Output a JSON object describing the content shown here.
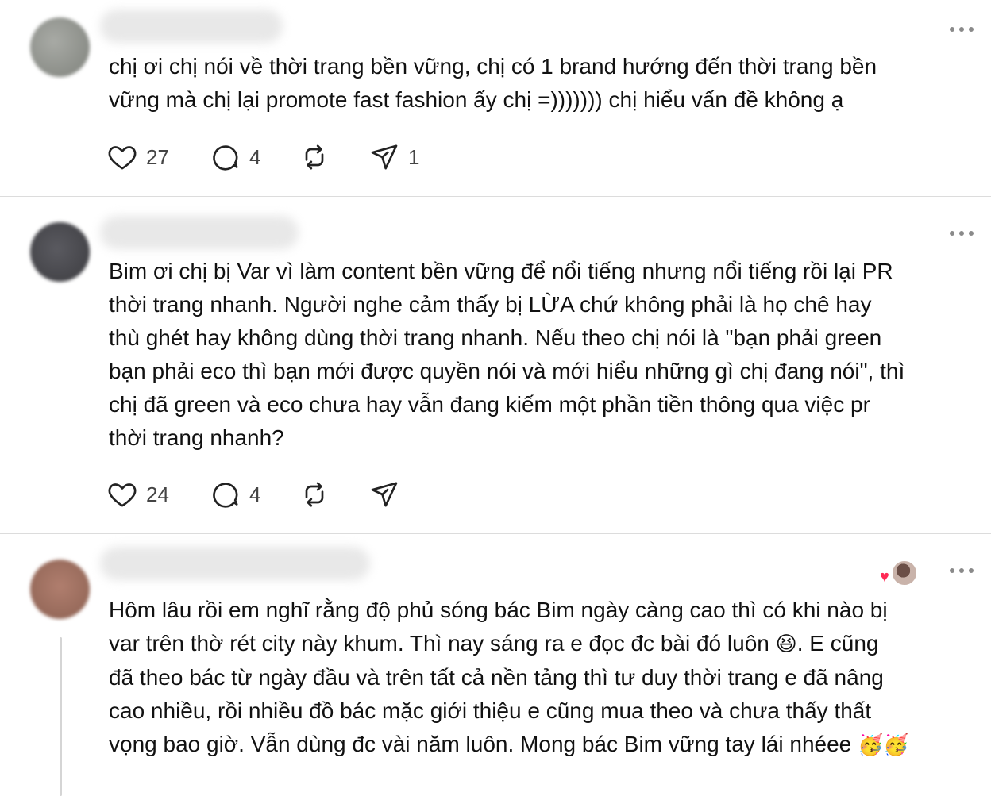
{
  "posts": [
    {
      "text": "chị ơi chị nói về thời trang bền vững, chị có 1 brand hướng đến thời trang bền\nvững mà chị lại promote fast fashion ấy chị =))))))) chị hiểu vấn đề không ạ",
      "likes": "27",
      "replies": "4",
      "reposts": "",
      "shares": "1"
    },
    {
      "text": "Bim ơi chị bị Var vì làm content bền vững để nổi tiếng nhưng nổi tiếng rồi lại PR\nthời trang nhanh. Người nghe cảm thấy bị LỪA chứ không phải là họ chê hay\nthù ghét hay không dùng thời trang nhanh. Nếu theo chị nói là \"bạn phải green\nbạn phải eco thì bạn mới được quyền nói và mới hiểu những gì chị đang nói\", thì\nchị đã green và eco chưa hay vẫn đang kiếm một phần tiền thông qua việc pr\nthời trang nhanh?",
      "likes": "24",
      "replies": "4",
      "reposts": "",
      "shares": ""
    },
    {
      "text_lines": [
        "Hôm lâu rồi em nghĩ rằng độ phủ sóng bác Bim ngày càng cao thì có khi nào bị",
        "var trên thờ rét city này khum. Thì nay sáng ra e đọc đc bài đó luôn",
        "đã theo bác từ ngày đầu và trên tất cả nền tảng thì tư duy thời trang e đã nâng",
        "cao nhiều, rồi nhiều đồ bác mặc giới thiệu e cũng mua theo và chưa thấy thất",
        "vọng bao giờ. Vẫn dùng đc vài năm luôn. Mong bác Bim vững tay lái nhéee"
      ],
      "line2_tail": ". E cũng",
      "emoji_laugh": "😆",
      "emoji_party": "🥳🥳"
    }
  ],
  "colors": {
    "heart_liked": "#ff2a55",
    "icon": "#222222",
    "divider": "#dcdcdc"
  },
  "icons": [
    "heart-icon",
    "comment-icon",
    "repost-icon",
    "send-icon",
    "more-options-icon"
  ]
}
